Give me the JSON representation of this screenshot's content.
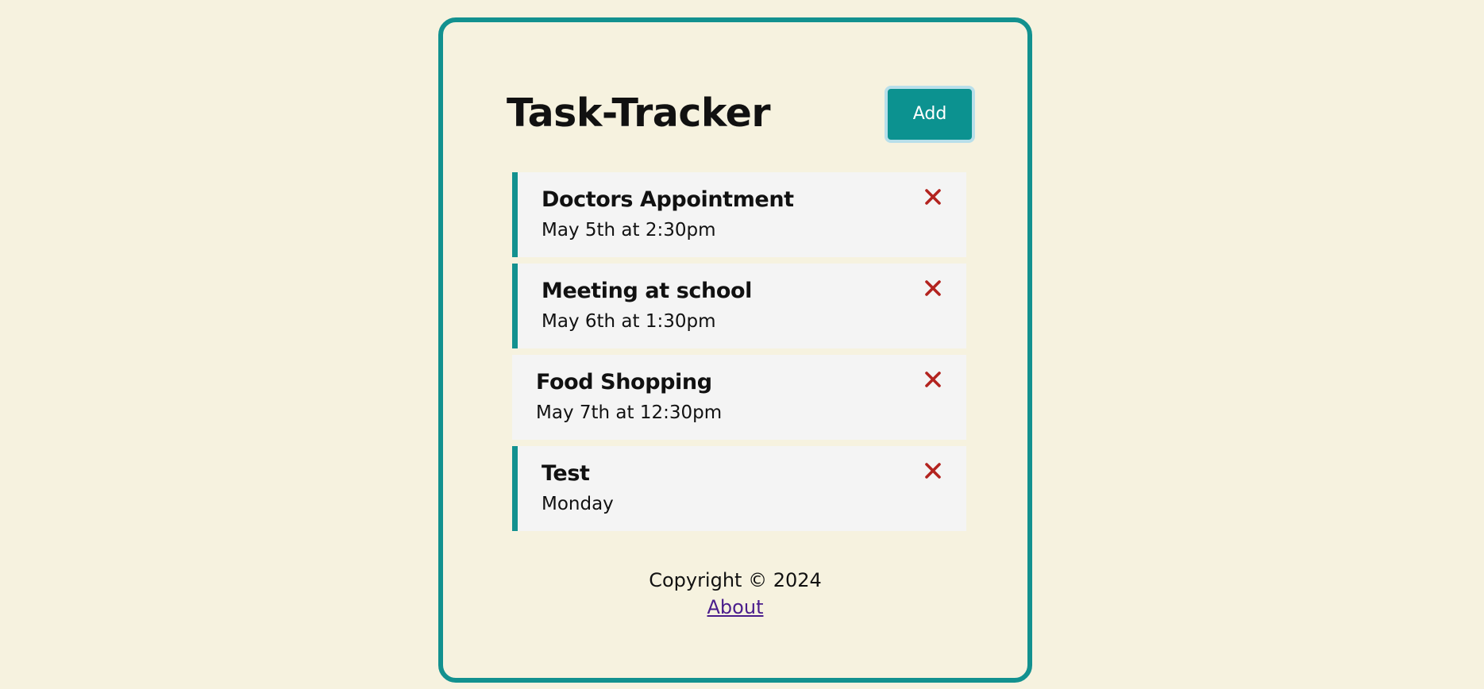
{
  "app": {
    "title": "Task-Tracker",
    "add_button_label": "Add"
  },
  "tasks": [
    {
      "text": "Doctors Appointment",
      "day": "May 5th at 2:30pm",
      "reminder": true
    },
    {
      "text": "Meeting at school",
      "day": "May 6th at 1:30pm",
      "reminder": true
    },
    {
      "text": "Food Shopping",
      "day": "May 7th at 12:30pm",
      "reminder": false
    },
    {
      "text": "Test",
      "day": "Monday",
      "reminder": true
    }
  ],
  "footer": {
    "copyright": "Copyright © 2024",
    "about_label": "About"
  },
  "icons": {
    "delete": "close-icon"
  },
  "colors": {
    "background": "#f6f2df",
    "accent": "#12918f",
    "button": "#0c9290",
    "task_background": "#f4f4f4",
    "delete": "#b3231f",
    "link": "#4a1d8c"
  }
}
